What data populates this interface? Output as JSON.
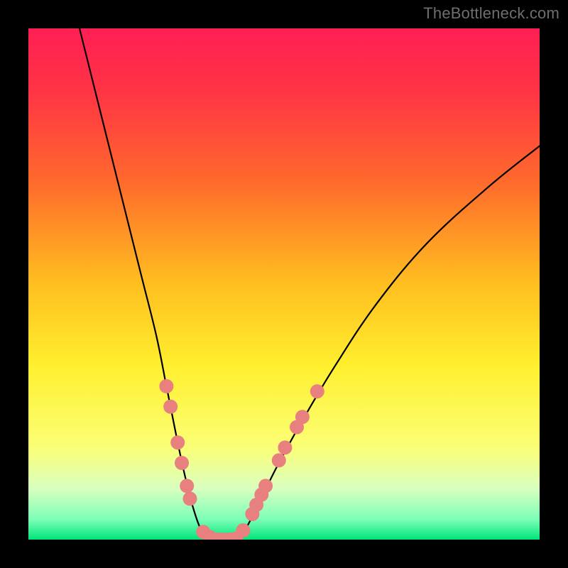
{
  "watermark": "TheBottleneck.com",
  "chart_data": {
    "type": "line",
    "title": "",
    "xlabel": "",
    "ylabel": "",
    "xlim": [
      0,
      100
    ],
    "ylim": [
      0,
      100
    ],
    "background_gradient_stops": [
      {
        "offset": 0.0,
        "color": "#ff1f54"
      },
      {
        "offset": 0.12,
        "color": "#ff3345"
      },
      {
        "offset": 0.3,
        "color": "#ff6a2c"
      },
      {
        "offset": 0.5,
        "color": "#ffbf20"
      },
      {
        "offset": 0.66,
        "color": "#ffef2e"
      },
      {
        "offset": 0.82,
        "color": "#fbff77"
      },
      {
        "offset": 0.9,
        "color": "#d9ffbf"
      },
      {
        "offset": 0.96,
        "color": "#7dffb8"
      },
      {
        "offset": 1.0,
        "color": "#00e57a"
      }
    ],
    "series": [
      {
        "name": "left-branch",
        "x": [
          10,
          14,
          18,
          22,
          25,
          27,
          29,
          30.5,
          32,
          33.5,
          35
        ],
        "y": [
          100,
          84,
          68,
          52,
          40,
          30,
          20,
          13,
          7,
          2.5,
          0
        ]
      },
      {
        "name": "valley-floor",
        "x": [
          35,
          36,
          37,
          38,
          39,
          40,
          41
        ],
        "y": [
          0,
          0,
          0,
          0,
          0,
          0,
          0
        ]
      },
      {
        "name": "right-branch",
        "x": [
          41,
          43,
          45.5,
          49,
          54,
          60,
          68,
          78,
          90,
          100
        ],
        "y": [
          0,
          3,
          8,
          15,
          24,
          34,
          46,
          58,
          69,
          77
        ]
      }
    ],
    "scatter": {
      "name": "pink-dots",
      "color": "#e98080",
      "radius": 10,
      "points": [
        {
          "x": 27.0,
          "y": 30
        },
        {
          "x": 27.8,
          "y": 26
        },
        {
          "x": 29.2,
          "y": 19
        },
        {
          "x": 30.0,
          "y": 15
        },
        {
          "x": 31.0,
          "y": 10.5
        },
        {
          "x": 31.6,
          "y": 8
        },
        {
          "x": 34.2,
          "y": 1.5
        },
        {
          "x": 35.5,
          "y": 0.5
        },
        {
          "x": 37.0,
          "y": 0.0
        },
        {
          "x": 38.2,
          "y": 0.0
        },
        {
          "x": 39.4,
          "y": 0.0
        },
        {
          "x": 40.6,
          "y": 0.2
        },
        {
          "x": 42.0,
          "y": 1.8
        },
        {
          "x": 43.8,
          "y": 5.0
        },
        {
          "x": 44.6,
          "y": 6.8
        },
        {
          "x": 45.6,
          "y": 8.8
        },
        {
          "x": 46.4,
          "y": 10.5
        },
        {
          "x": 49.0,
          "y": 15.5
        },
        {
          "x": 50.2,
          "y": 18.0
        },
        {
          "x": 52.5,
          "y": 22.0
        },
        {
          "x": 53.6,
          "y": 24.0
        },
        {
          "x": 56.5,
          "y": 29.0
        }
      ]
    }
  }
}
